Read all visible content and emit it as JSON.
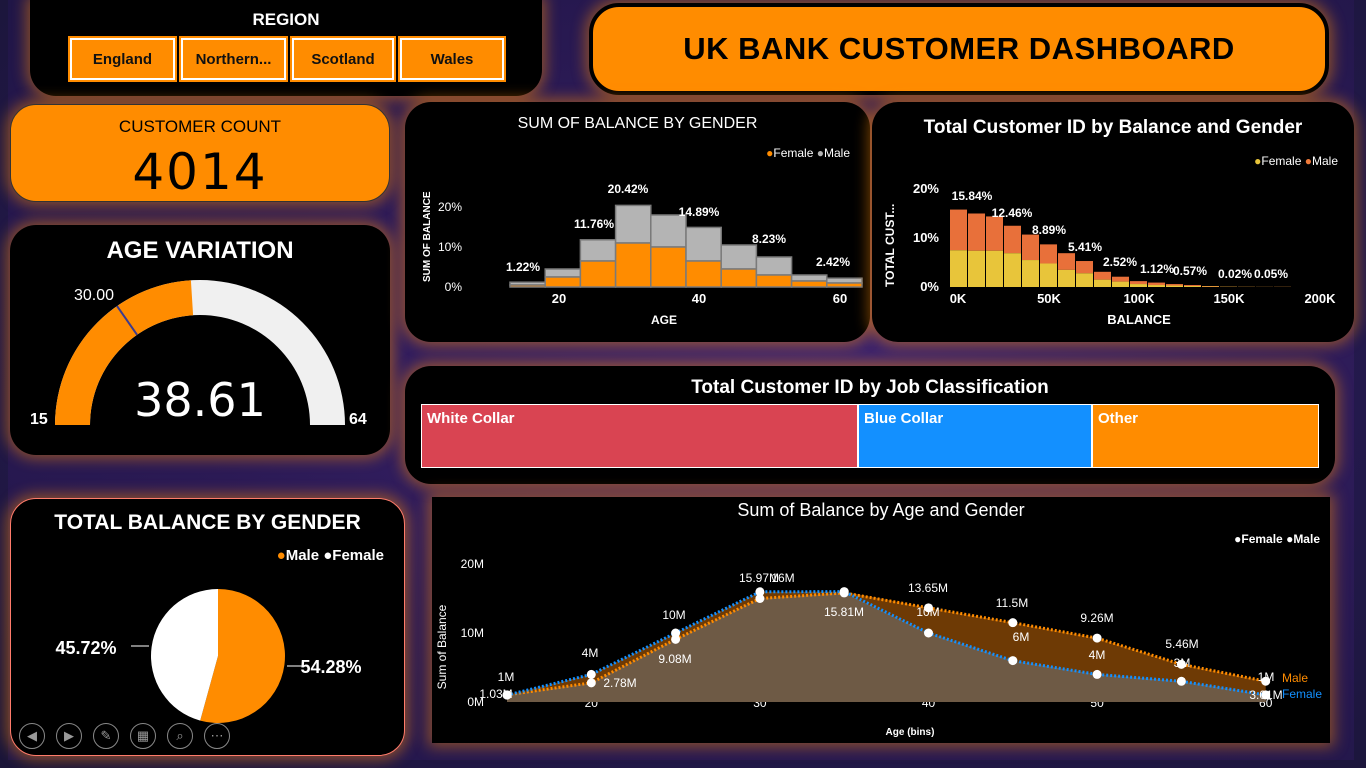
{
  "region": {
    "title": "REGION",
    "buttons": [
      "England",
      "Northern...",
      "Scotland",
      "Wales"
    ]
  },
  "header": {
    "title": "UK BANK CUSTOMER DASHBOARD"
  },
  "customer_count": {
    "label": "CUSTOMER COUNT",
    "value": "4014"
  },
  "age_variation": {
    "title": "AGE VARIATION",
    "min": "15",
    "max": "64",
    "value": "38.61",
    "target": "30.00",
    "fraction": 0.48
  },
  "sum_balance_gender": {
    "title": "SUM OF BALANCE BY GENDER",
    "legend": [
      "Female",
      "Male"
    ],
    "xlabel": "AGE",
    "ylabel": "SUM OF BALANCE",
    "yticks": [
      "20%",
      "10%",
      "0%"
    ],
    "xticks": [
      "20",
      "40",
      "60"
    ],
    "labels": [
      "1.22%",
      "11.76%",
      "20.42%",
      "14.89%",
      "8.23%",
      "2.42%"
    ]
  },
  "total_customer_balance": {
    "title": "Total Customer ID by Balance and Gender",
    "legend": [
      "Female",
      "Male"
    ],
    "xlabel": "BALANCE",
    "ylabel": "TOTAL CUST...",
    "yticks": [
      "20%",
      "10%",
      "0%"
    ],
    "xticks": [
      "0K",
      "50K",
      "100K",
      "150K",
      "200K"
    ],
    "labels": [
      "15.84%",
      "12.46%",
      "8.89%",
      "5.41%",
      "2.52%",
      "1.12%",
      "0.57%",
      "0.02%",
      "0.05%"
    ]
  },
  "job": {
    "title": "Total Customer ID by Job Classification",
    "items": [
      "White Collar",
      "Blue Collar",
      "Other"
    ]
  },
  "total_balance_gender": {
    "title": "TOTAL BALANCE BY GENDER",
    "legend": [
      "Male",
      "Female"
    ],
    "male_pct": "54.28%",
    "female_pct": "45.72%"
  },
  "sum_balance_age": {
    "title": "Sum of Balance by Age and Gender",
    "legend": [
      "Female",
      "Male"
    ],
    "xlabel": "Age (bins)",
    "ylabel": "Sum of Balance",
    "yticks": [
      "20M",
      "10M",
      "0M"
    ],
    "xticks": [
      "20",
      "30",
      "40",
      "50",
      "60"
    ],
    "end_labels": [
      "Male",
      "Female"
    ]
  },
  "colors": {
    "orange": "#ff8c00",
    "gray": "#b4b4b4",
    "yellow": "#e8c53a",
    "red": "#d94452",
    "blue": "#1390ff",
    "dark_orange": "#6e3a05"
  },
  "chart_data": [
    {
      "type": "area",
      "title": "SUM OF BALANCE BY GENDER",
      "xlabel": "AGE",
      "ylabel": "SUM OF BALANCE",
      "x": [
        15,
        20,
        25,
        30,
        35,
        40,
        45,
        50,
        55,
        60
      ],
      "series": [
        {
          "name": "Female",
          "values": [
            0.5,
            2.5,
            6.5,
            11,
            10,
            6.5,
            4.5,
            3,
            1.5,
            1
          ]
        },
        {
          "name": "Male",
          "values": [
            0.7,
            2,
            5.3,
            9.4,
            8,
            8.4,
            6,
            4.5,
            1.5,
            1.2
          ]
        }
      ],
      "data_labels": [
        "1.22%",
        "11.76%",
        "20.42%",
        "14.89%",
        "8.23%",
        "2.42%"
      ],
      "ylim": [
        0,
        20
      ]
    },
    {
      "type": "bar",
      "title": "Total Customer ID by Balance and Gender",
      "xlabel": "BALANCE",
      "ylabel": "TOTAL CUST...",
      "categories": [
        "0K",
        "50K",
        "100K",
        "150K",
        "200K"
      ],
      "series": [
        {
          "name": "Female",
          "values": [
            7.5,
            7,
            5.5,
            3.5,
            1.5,
            0.6,
            0.3,
            0.01,
            0.02
          ]
        },
        {
          "name": "Male",
          "values": [
            8.3,
            5.5,
            3.4,
            1.9,
            1,
            0.5,
            0.3,
            0.01,
            0.03
          ]
        }
      ],
      "data_labels": [
        "15.84%",
        "12.46%",
        "8.89%",
        "5.41%",
        "2.52%",
        "1.12%",
        "0.57%",
        "0.02%",
        "0.05%"
      ]
    },
    {
      "type": "bar",
      "title": "Total Customer ID by Job Classification",
      "categories": [
        "White Collar",
        "Blue Collar",
        "Other"
      ],
      "values": [
        49,
        25,
        24
      ]
    },
    {
      "type": "pie",
      "title": "TOTAL BALANCE BY GENDER",
      "categories": [
        "Male",
        "Female"
      ],
      "values": [
        54.28,
        45.72
      ]
    },
    {
      "type": "line",
      "title": "Sum of Balance by Age and Gender",
      "xlabel": "Age (bins)",
      "ylabel": "Sum of Balance",
      "x": [
        15,
        20,
        25,
        30,
        35,
        40,
        45,
        50,
        55,
        60
      ],
      "series": [
        {
          "name": "Female",
          "values": [
            1,
            4,
            10,
            15.97,
            16,
            10,
            6,
            4,
            3,
            1.03
          ]
        },
        {
          "name": "Male",
          "values": [
            1.03,
            2.78,
            9.08,
            15,
            15.81,
            13.65,
            11.5,
            9.26,
            5.46,
            3.01
          ]
        }
      ],
      "point_labels": [
        "1M",
        "1.03M",
        "4M",
        "2.78M",
        "10M",
        "9.08M",
        "15.97M",
        "16M",
        "15.81M",
        "13.65M",
        "10M",
        "11.5M",
        "6M",
        "9.26M",
        "4M",
        "5.46M",
        "3M",
        "1M",
        "3.01M"
      ],
      "ylim": [
        0,
        20
      ]
    }
  ]
}
